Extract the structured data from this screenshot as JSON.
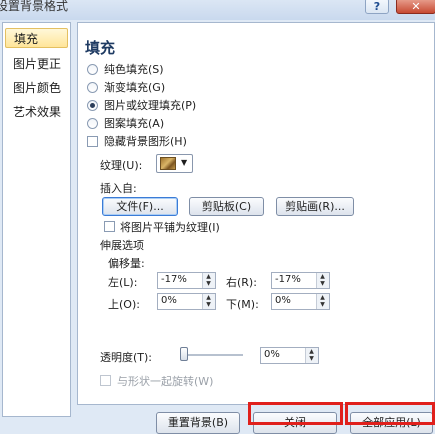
{
  "window": {
    "title": "设置背景格式",
    "help_icon": "?",
    "close_icon": "✕"
  },
  "sidebar": {
    "items": [
      {
        "label": "填充",
        "selected": true
      },
      {
        "label": "图片更正"
      },
      {
        "label": "图片颜色"
      },
      {
        "label": "艺术效果"
      }
    ]
  },
  "panel": {
    "heading": "填充",
    "fill_options": [
      {
        "label": "纯色填充(S)"
      },
      {
        "label": "渐变填充(G)"
      },
      {
        "label": "图片或纹理填充(P)",
        "checked": true
      },
      {
        "label": "图案填充(A)"
      }
    ],
    "hide_bg_graphics": "隐藏背景图形(H)",
    "texture_label": "纹理(U):",
    "insert_from_label": "插入自:",
    "insert_buttons": {
      "file": "文件(F)...",
      "clipboard": "剪贴板(C)",
      "clipart": "剪贴画(R)..."
    },
    "tile_checkbox": "将图片平铺为纹理(I)",
    "stretch_options": "伸展选项",
    "offset_label": "偏移量:",
    "offsets": {
      "left_label": "左(L):",
      "left_value": "-17%",
      "right_label": "右(R):",
      "right_value": "-17%",
      "top_label": "上(O):",
      "top_value": "0%",
      "bottom_label": "下(M):",
      "bottom_value": "0%"
    },
    "transparency_label": "透明度(T):",
    "transparency_value": "0%",
    "transparency_fraction": 0,
    "rotate_with_shape": "与形状一起旋转(W)"
  },
  "footer": {
    "reset_bg": "重置背景(B)",
    "close": "关闭",
    "apply_all": "全部应用(L)"
  },
  "colors": {
    "highlight": "#e0201c",
    "selected_item": "#ffe59a"
  }
}
